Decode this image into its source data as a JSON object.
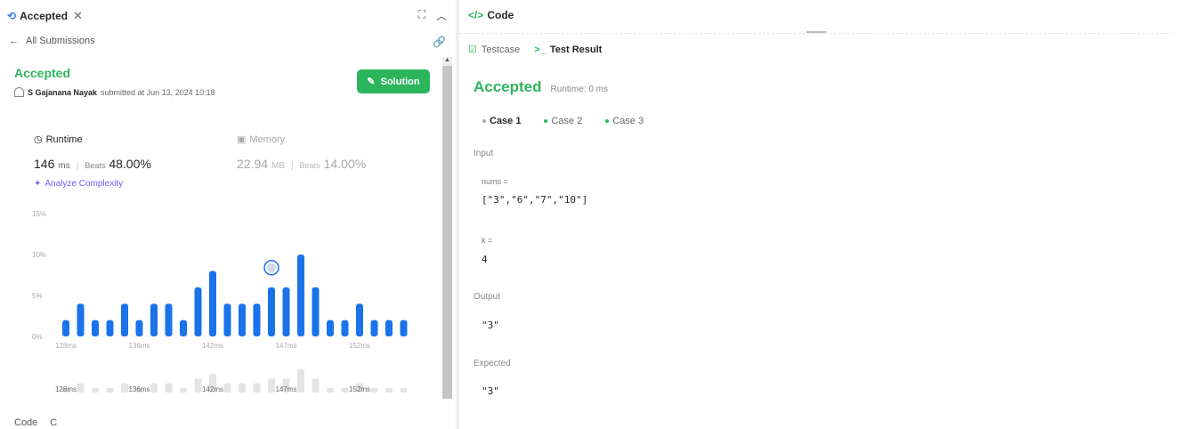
{
  "tab": {
    "icon": "history-icon",
    "label": "Accepted",
    "close": "✕"
  },
  "nav": {
    "back_label": "All Submissions"
  },
  "submission": {
    "status": "Accepted",
    "author": "S Gajanana Nayak",
    "submitted_text": "submitted at Jun 13, 2024 10:18",
    "solution_label": "Solution"
  },
  "runtime": {
    "label": "Runtime",
    "value": "146",
    "unit": "ms",
    "beats_label": "Beats",
    "beats_value": "48.00%"
  },
  "memory": {
    "label": "Memory",
    "value": "22.94",
    "unit": "MB",
    "beats_label": "Beats",
    "beats_value": "14.00%"
  },
  "analyze_label": "Analyze Complexity",
  "chart_data": {
    "type": "bar",
    "y_tick_labels": [
      "15%",
      "10%",
      "5%",
      "0%"
    ],
    "ylim": [
      0,
      15
    ],
    "x_tick_labels": [
      "128ms",
      "136ms",
      "142ms",
      "147ms",
      "152ms"
    ],
    "values": [
      2,
      4,
      2,
      2,
      4,
      2,
      4,
      4,
      2,
      6,
      8,
      4,
      4,
      4,
      6,
      6,
      10,
      6,
      2,
      2,
      4,
      2,
      2,
      2
    ],
    "highlight_index": 14,
    "bar_color": "#1a73e8",
    "mini_bar_color": "#e4e4e4",
    "mini_labels": [
      "128ms",
      "136ms",
      "142ms",
      "147ms",
      "152ms"
    ]
  },
  "bottom": {
    "code_label": "Code",
    "lang": "C"
  },
  "code_panel": {
    "title": "Code"
  },
  "result_tabs": [
    {
      "label": "Testcase",
      "active": false
    },
    {
      "label": "Test Result",
      "active": true
    }
  ],
  "result": {
    "status": "Accepted",
    "runtime_text": "Runtime: 0 ms",
    "cases": [
      "Case 1",
      "Case 2",
      "Case 3"
    ],
    "input_label": "Input",
    "vars": [
      {
        "name": "nums =",
        "value": "[\"3\",\"6\",\"7\",\"10\"]"
      },
      {
        "name": "k =",
        "value": "4"
      }
    ],
    "output_label": "Output",
    "output_value": "\"3\"",
    "expected_label": "Expected",
    "expected_value": "\"3\""
  },
  "colors": {
    "accent_green": "#2db55d",
    "bar_blue": "#1a73e8",
    "purple": "#7a5af8"
  }
}
